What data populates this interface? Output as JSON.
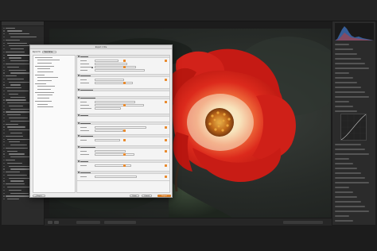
{
  "app": {
    "name": "Lightroom Classic"
  },
  "dialog": {
    "title": "Export 1 File",
    "export_to_label": "Export To:",
    "export_to_value": "Hard Drive",
    "buttons": {
      "plugin_manager": "Plug-in Manager...",
      "done": "Done",
      "cancel": "Cancel",
      "export": "Export"
    }
  },
  "colors": {
    "accent": "#e98a2c",
    "panel": "#2b2b2b",
    "dialog_bg": "#ececec",
    "petal_red": "#d8221a",
    "petal_center": "#f7ecd2"
  },
  "icons": [
    "histogram-icon",
    "tone-curve-icon",
    "disclosure-triangle-icon"
  ]
}
